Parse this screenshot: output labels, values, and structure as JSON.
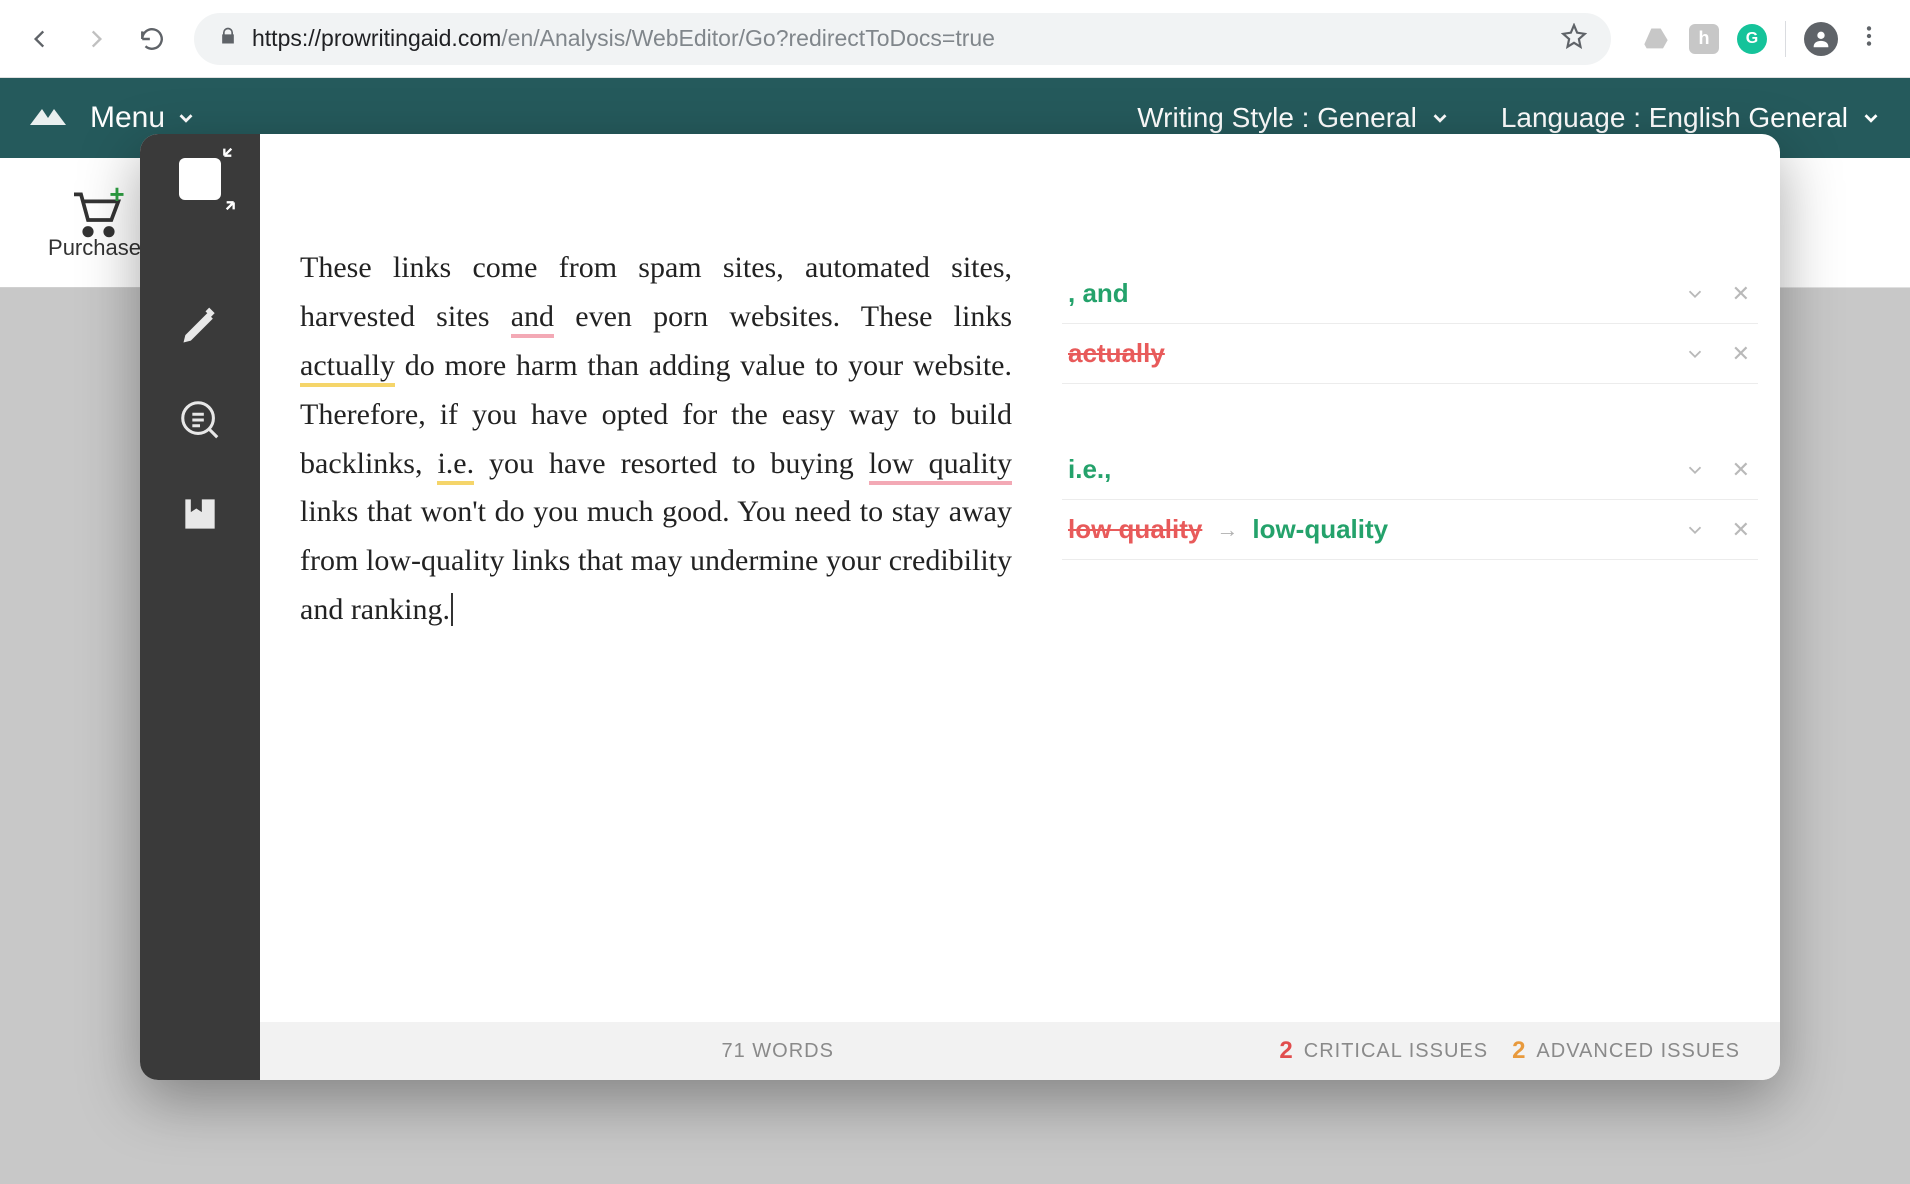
{
  "browser": {
    "url_host": "https://prowritingaid.com",
    "url_path": "/en/Analysis/WebEditor/Go?redirectToDocs=true"
  },
  "app_header": {
    "menu_label": "Menu",
    "writing_style_label": "Writing Style : General",
    "language_label": "Language : English General"
  },
  "purchase": {
    "label": "Purchase"
  },
  "document": {
    "pre1": "These links come from spam sites, automated sites, harvested sites ",
    "hl_and": "and",
    "post1": " even porn websites. These links ",
    "hl_actually": "actually",
    "post2": " do more harm than adding value to your website. Therefore, if you have opted for the easy way to build backlinks, ",
    "hl_ie": "i.e.",
    "post3": " you have resorted to buying ",
    "hl_lowquality": "low quality",
    "post4": " links that won't do you much good. You need to stay away from low-quality links that may undermine your credibility and ranking."
  },
  "suggestions": [
    {
      "type": "insert",
      "text": ", and"
    },
    {
      "type": "delete",
      "text": "actually"
    },
    {
      "type": "insert",
      "text": "i.e.,"
    },
    {
      "type": "replace",
      "from": "low quality",
      "to": "low-quality"
    }
  ],
  "footer": {
    "word_count_num": "71",
    "word_count_label": "WORDS",
    "critical_count": "2",
    "critical_label": "CRITICAL ISSUES",
    "advanced_count": "2",
    "advanced_label": "ADVANCED ISSUES"
  }
}
